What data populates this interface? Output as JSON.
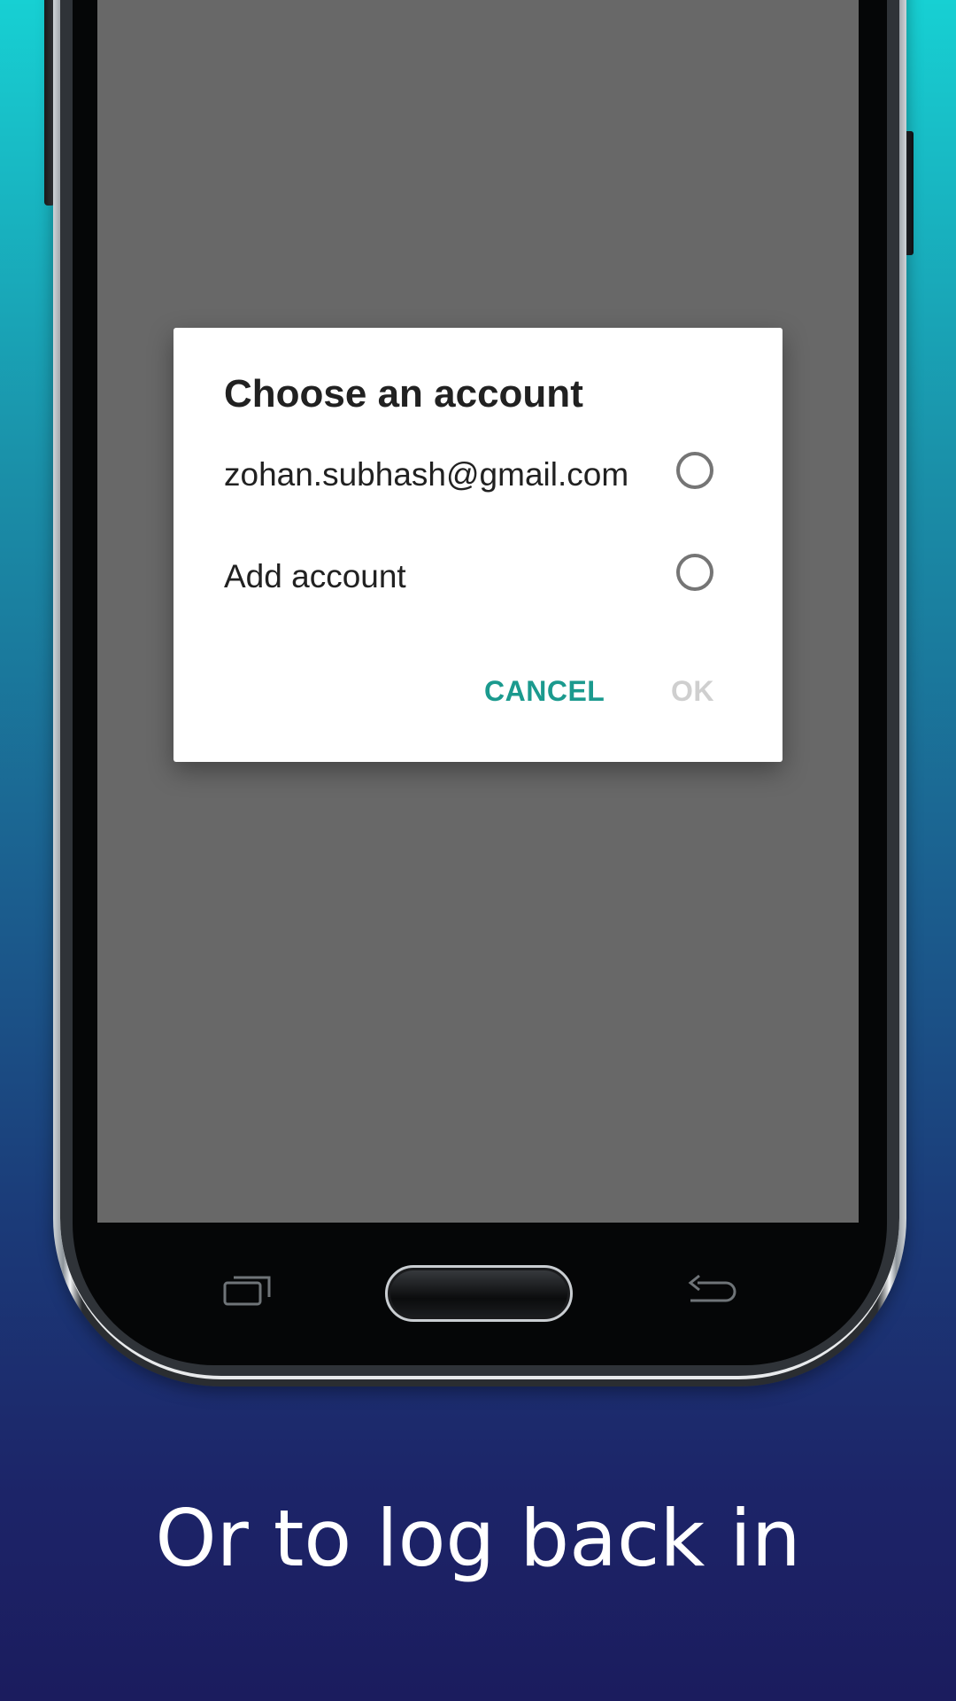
{
  "dialog": {
    "title": "Choose an account",
    "options": [
      {
        "label": "zohan.subhash@gmail.com",
        "selected": false
      },
      {
        "label": "Add account",
        "selected": false
      }
    ],
    "cancel_label": "CANCEL",
    "ok_label": "OK",
    "ok_enabled": false
  },
  "caption": "Or to log back in",
  "colors": {
    "accent": "#1b9a8e",
    "scrim": "#686868",
    "background_top": "#17d0d3",
    "background_bottom": "#1b1c5e"
  },
  "nav_keys": {
    "recent": "recent-apps-icon",
    "home": "home-button",
    "back": "back-arrow-icon"
  }
}
